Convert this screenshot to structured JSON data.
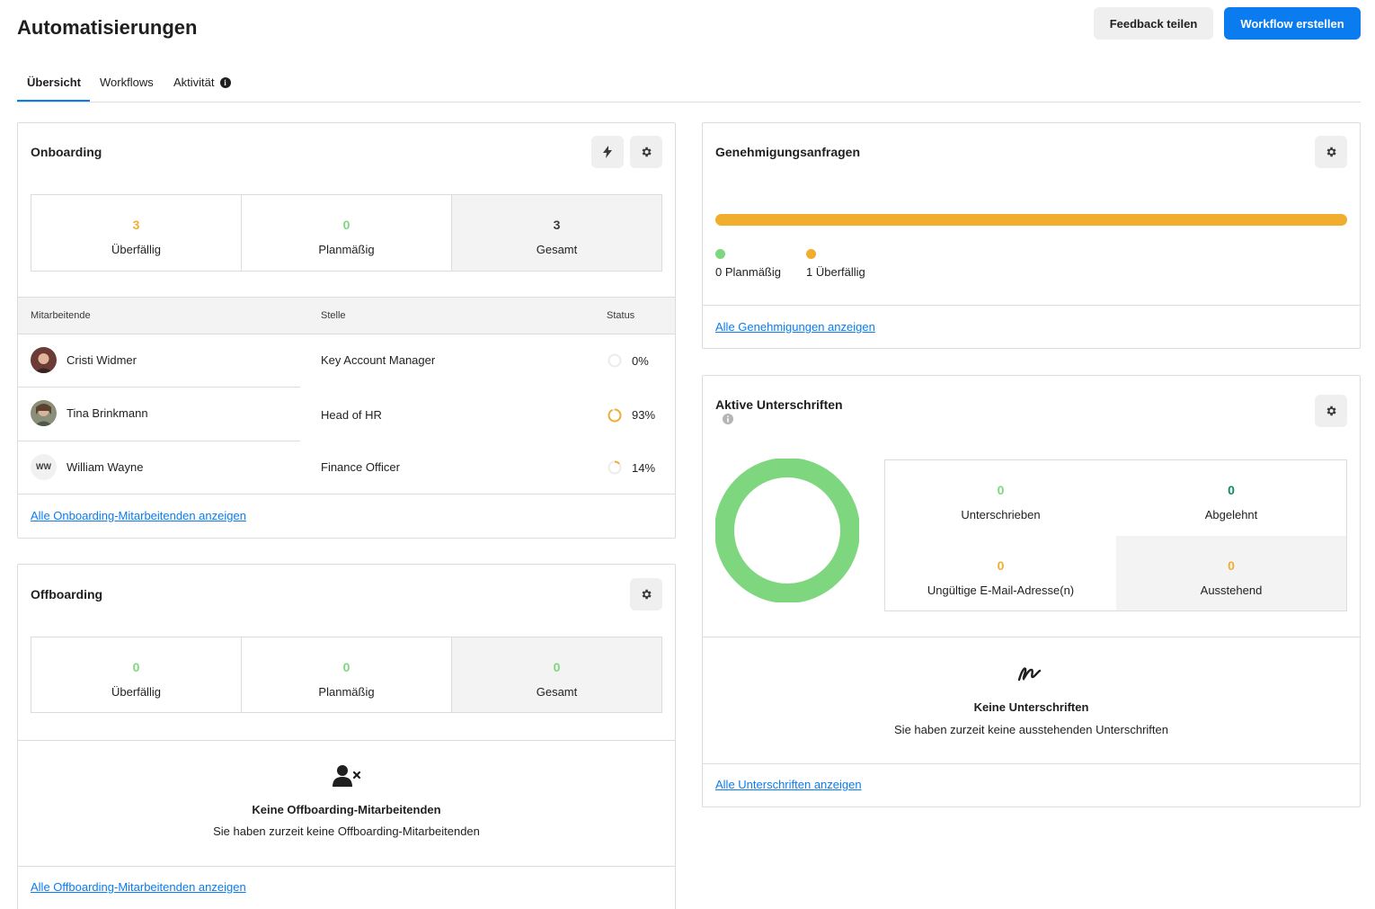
{
  "page": {
    "title": "Automatisierungen",
    "feedback_label": "Feedback teilen",
    "create_label": "Workflow erstellen"
  },
  "tabs": [
    {
      "label": "Übersicht",
      "active": true
    },
    {
      "label": "Workflows",
      "active": false
    },
    {
      "label": "Aktivität",
      "active": false,
      "info": "i"
    }
  ],
  "onboarding": {
    "title": "Onboarding",
    "stats": [
      {
        "value": "3",
        "label": "Überfällig",
        "color": "#f0ad2e"
      },
      {
        "value": "0",
        "label": "Planmäßig",
        "color": "#7ed67e"
      },
      {
        "value": "3",
        "label": "Gesamt",
        "color": "#3a3a3a"
      }
    ],
    "columns": [
      "Mitarbeitende",
      "Stelle",
      "Status"
    ],
    "rows": [
      {
        "name": "Cristi Widmer",
        "role": "Key Account Manager",
        "status": "0%",
        "progress": 0,
        "avatar": "photo"
      },
      {
        "name": "Tina Brinkmann",
        "role": "Head of HR",
        "status": "93%",
        "progress": 93,
        "avatar": "photo"
      },
      {
        "name": "William Wayne",
        "role": "Finance Officer",
        "status": "14%",
        "progress": 14,
        "avatar": "WW"
      }
    ],
    "link": "Alle Onboarding-Mitarbeitenden anzeigen"
  },
  "offboarding": {
    "title": "Offboarding",
    "stats": [
      {
        "value": "0",
        "label": "Überfällig",
        "color": "#7ed67e"
      },
      {
        "value": "0",
        "label": "Planmäßig",
        "color": "#7ed67e"
      },
      {
        "value": "0",
        "label": "Gesamt",
        "color": "#7ed67e"
      }
    ],
    "empty_icon": "user-remove-icon",
    "empty_title": "Keine Offboarding-Mitarbeitenden",
    "empty_text": "Sie haben zurzeit keine Offboarding-Mitarbeitenden",
    "link": "Alle Offboarding-Mitarbeitenden anzeigen"
  },
  "approvals": {
    "title": "Genehmigungsanfragen",
    "legend": [
      {
        "label": "0 Planmäßig",
        "color": "#7ed67e"
      },
      {
        "label": "1 Überfällig",
        "color": "#f0ad2e"
      }
    ],
    "bar_fraction_overdue": 1,
    "link": "Alle Genehmigungen anzeigen"
  },
  "signatures": {
    "title": "Aktive Unterschriften",
    "stats": [
      {
        "value": "0",
        "label": "Unterschrieben",
        "color": "#7ed67e"
      },
      {
        "value": "0",
        "label": "Abgelehnt",
        "color": "#0f8a5f"
      },
      {
        "value": "0",
        "label": "Ungültige E-Mail-Adresse(n)",
        "color": "#f0ad2e"
      },
      {
        "value": "0",
        "label": "Ausstehend",
        "color": "#f0ad2e"
      }
    ],
    "donut_color": "#7ed67e",
    "empty_icon": "signature-icon",
    "empty_title": "Keine Unterschriften",
    "empty_text": "Sie haben zurzeit keine ausstehenden Unterschriften",
    "link": "Alle Unterschriften anzeigen"
  }
}
